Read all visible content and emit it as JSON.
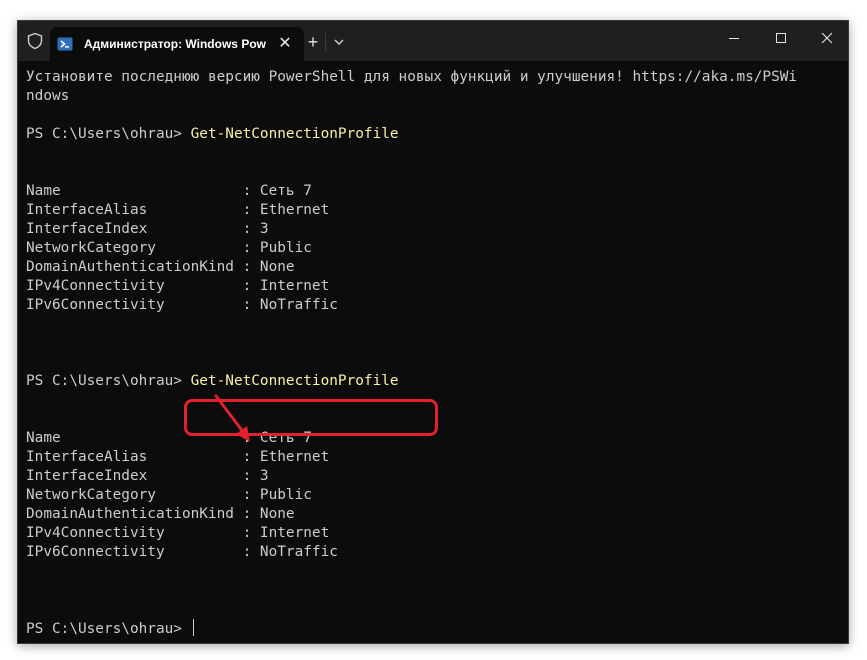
{
  "window": {
    "tab_title": "Администратор: Windows PowerShell",
    "accent": "#e2202e"
  },
  "terminal": {
    "banner_line1": "Установите последнюю версию PowerShell для новых функций и улучшения! https://aka.ms/PSWi",
    "banner_line2": "ndows",
    "prompt": "PS C:\\Users\\ohrau>",
    "command": "Get-NetConnectionProfile",
    "output1": [
      "Name                     : Сеть 7",
      "InterfaceAlias           : Ethernet",
      "InterfaceIndex           : 3",
      "NetworkCategory          : Public",
      "DomainAuthenticationKind : None",
      "IPv4Connectivity         : Internet",
      "IPv6Connectivity         : NoTraffic"
    ],
    "output2": [
      "Name                     : Сеть 7",
      "InterfaceAlias           : Ethernet",
      "InterfaceIndex           : 3",
      "NetworkCategory          : Public",
      "DomainAuthenticationKind : None",
      "IPv4Connectivity         : Internet",
      "IPv6Connectivity         : NoTraffic"
    ]
  }
}
